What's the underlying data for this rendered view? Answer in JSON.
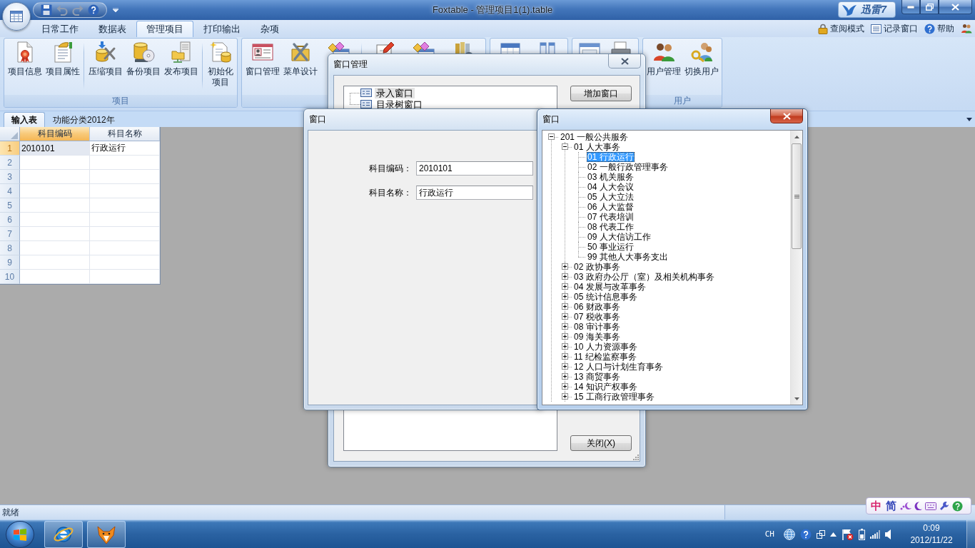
{
  "title_bar": {
    "quick_access": [
      {
        "disabled": false
      },
      {
        "disabled": true
      },
      {
        "disabled": true
      },
      {
        "disabled": false
      }
    ],
    "title": "Foxtable - 管理项目1(1).table",
    "widget_label": "迅雷7"
  },
  "ribbon": {
    "tabs": [
      {
        "label": "日常工作",
        "selected": false
      },
      {
        "label": "数据表",
        "selected": false
      },
      {
        "label": "管理项目",
        "selected": true
      },
      {
        "label": "打印输出",
        "selected": false
      },
      {
        "label": "杂项",
        "selected": false
      }
    ],
    "links": [
      "查阅模式",
      "记录窗口",
      "帮助"
    ],
    "groups": [
      {
        "label": "项目",
        "buttons": [
          "项目信息",
          "项目属性",
          "压缩项目",
          "备份项目",
          "发布项目",
          "初始化项目"
        ]
      },
      {
        "buttons": [
          "窗口管理",
          "菜单设计"
        ]
      },
      {
        "label": "用户",
        "buttons": [
          "用户管理",
          "切换用户"
        ]
      }
    ]
  },
  "doc_tabs": [
    {
      "label": "输入表",
      "selected": true
    },
    {
      "label": "功能分类2012年",
      "selected": false
    }
  ],
  "table": {
    "columns": [
      {
        "label": "科目编码",
        "selected": true
      },
      {
        "label": "科目名称",
        "selected": false
      }
    ],
    "rows": [
      {
        "number": "1",
        "selected": true,
        "cells": [
          "2010101",
          "行政运行"
        ]
      },
      {
        "number": "2",
        "selected": false
      },
      {
        "number": "3",
        "selected": false
      },
      {
        "number": "4",
        "selected": false
      },
      {
        "number": "5",
        "selected": false
      },
      {
        "number": "6",
        "selected": false
      },
      {
        "number": "7",
        "selected": false
      },
      {
        "number": "8",
        "selected": false
      },
      {
        "number": "9",
        "selected": false
      },
      {
        "number": "10",
        "selected": false
      }
    ]
  },
  "window_manager": {
    "title": "窗口管理",
    "active": false,
    "items": [
      {
        "label": "录入窗口",
        "selected": true
      },
      {
        "label": "目录树窗口",
        "selected": false
      }
    ],
    "buttons": [
      "增加窗口",
      "关闭(X)"
    ]
  },
  "form_window": {
    "title": "窗口",
    "active": false,
    "fields": [
      {
        "label": "科目编码：",
        "value": "2010101"
      },
      {
        "label": "科目名称：",
        "value": "行政运行"
      }
    ]
  },
  "tree_window": {
    "title": "窗口",
    "active": true,
    "tree": [
      {
        "label": "201 一般公共服务",
        "expanded": true,
        "selected": false,
        "children": [
          {
            "label": "01 人大事务",
            "expanded": true,
            "selected": false,
            "children": [
              {
                "label": "01 行政运行",
                "selected": true
              },
              {
                "label": "02 一般行政管理事务",
                "selected": false
              },
              {
                "label": "03 机关服务",
                "selected": false
              },
              {
                "label": "04 人大会议",
                "selected": false
              },
              {
                "label": "05 人大立法",
                "selected": false
              },
              {
                "label": "06 人大监督",
                "selected": false
              },
              {
                "label": "07 代表培训",
                "selected": false
              },
              {
                "label": "08 代表工作",
                "selected": false
              },
              {
                "label": "09 人大信访工作",
                "selected": false
              },
              {
                "label": "50 事业运行",
                "selected": false
              },
              {
                "label": "99 其他人大事务支出",
                "selected": false
              }
            ]
          },
          {
            "label": "02 政协事务",
            "expanded": false,
            "selected": false
          },
          {
            "label": "03 政府办公厅（室）及相关机构事务",
            "expanded": false,
            "selected": false
          },
          {
            "label": "04 发展与改革事务",
            "expanded": false,
            "selected": false
          },
          {
            "label": "05 统计信息事务",
            "expanded": false,
            "selected": false
          },
          {
            "label": "06 财政事务",
            "expanded": false,
            "selected": false
          },
          {
            "label": "07 税收事务",
            "expanded": false,
            "selected": false
          },
          {
            "label": "08 审计事务",
            "expanded": false,
            "selected": false
          },
          {
            "label": "09 海关事务",
            "expanded": false,
            "selected": false
          },
          {
            "label": "10 人力资源事务",
            "expanded": false,
            "selected": false
          },
          {
            "label": "11 纪检监察事务",
            "expanded": false,
            "selected": false
          },
          {
            "label": "12 人口与计划生育事务",
            "expanded": false,
            "selected": false
          },
          {
            "label": "13 商贸事务",
            "expanded": false,
            "selected": false
          },
          {
            "label": "14 知识产权事务",
            "expanded": false,
            "selected": false
          },
          {
            "label": "15 工商行政管理事务",
            "expanded": false,
            "selected": false
          }
        ]
      }
    ]
  },
  "status_bar": {
    "text": "就绪"
  },
  "ime_toolbar": {
    "modes": [
      "中",
      "简"
    ]
  },
  "taskbar": {
    "language": "CH",
    "time": "0:09",
    "date": "2012/11/22"
  }
}
